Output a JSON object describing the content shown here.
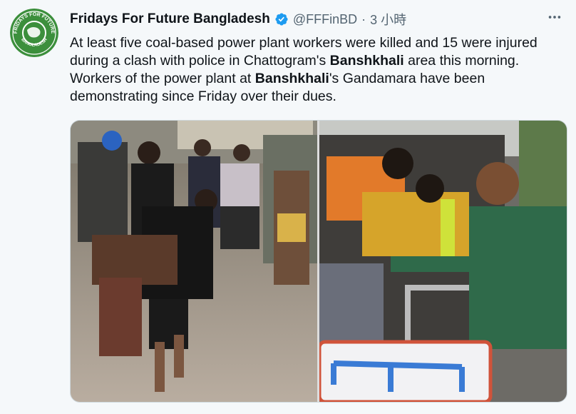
{
  "account": {
    "display_name": "Fridays For Future Bangladesh",
    "handle": "@FFFinBD",
    "separator": "·",
    "timestamp": "3 小時",
    "verified": true,
    "avatar_text_top": "FRIDAYS FOR FUTURE",
    "avatar_text_bottom": "BANGLADESH",
    "avatar_color": "#3c8f3c"
  },
  "tweet": {
    "line1_pre": "At least five coal-based power plant workers were killed and 15 were injured during a clash with police in Chattogram's ",
    "line1_bold": "Banshkhali",
    "line1_post": " area this morning.",
    "line2_pre": "Workers of the power plant at ",
    "line2_bold": "Banshkhali",
    "line2_post": "'s Gandamara have been demonstrating since Friday over their dues."
  },
  "media": {
    "count": 2,
    "photo1_icon": "photo-image-icon",
    "photo2_icon": "photo-image-icon"
  },
  "colors": {
    "verified_blue": "#1d9bf0",
    "secondary_text": "#536471",
    "background": "#f5f8fa"
  }
}
